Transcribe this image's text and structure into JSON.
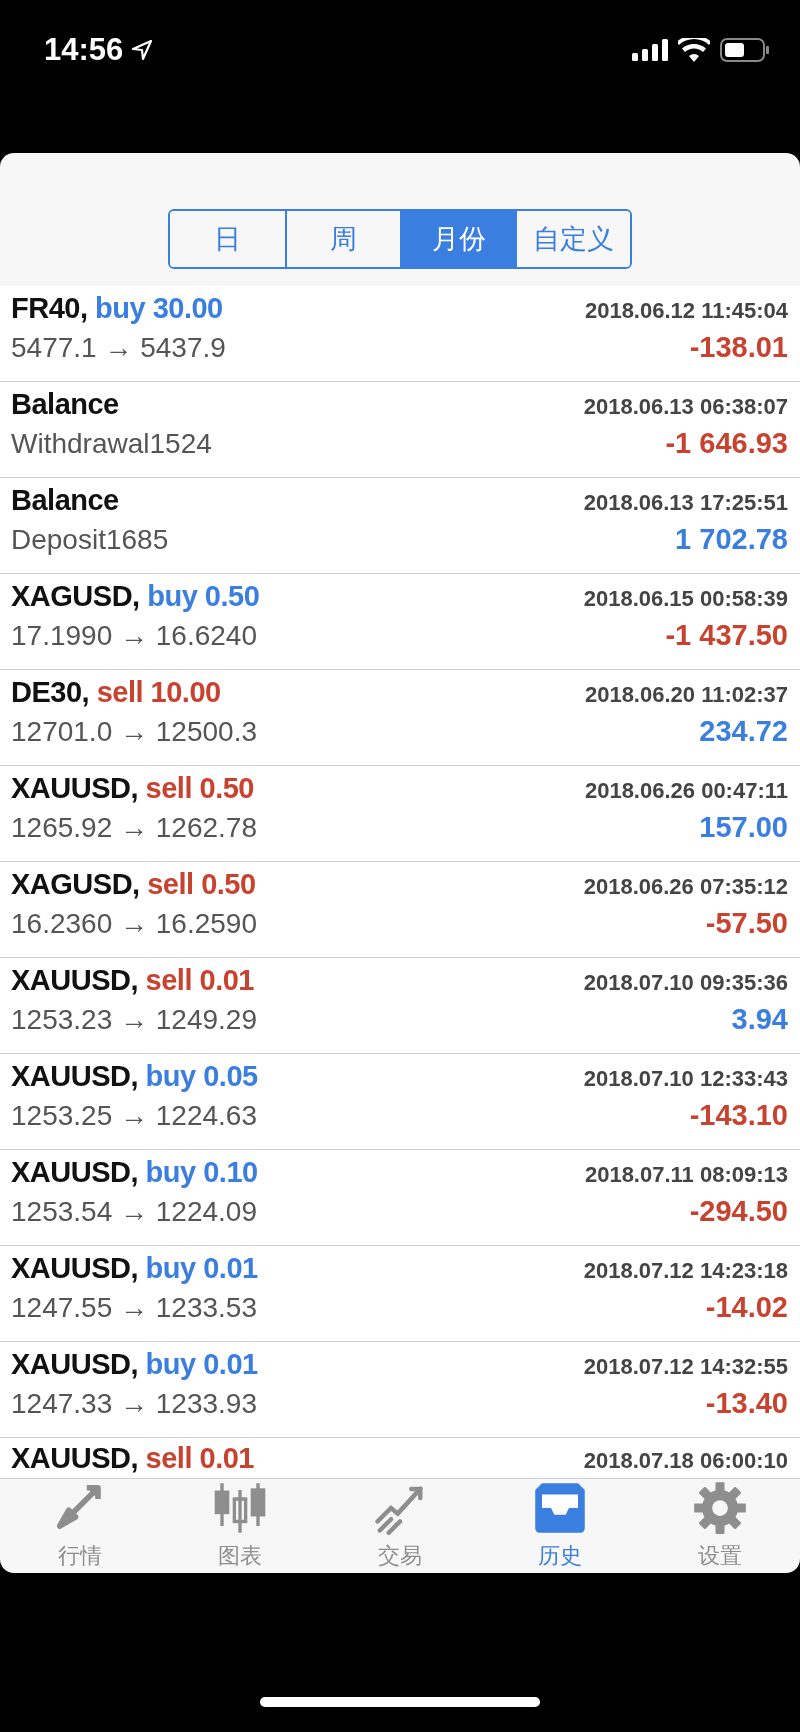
{
  "status_bar": {
    "time": "14:56"
  },
  "period_tabs": [
    {
      "label": "日",
      "selected": false
    },
    {
      "label": "周",
      "selected": false
    },
    {
      "label": "月份",
      "selected": true
    },
    {
      "label": "自定义",
      "selected": false
    }
  ],
  "history": [
    {
      "symbol": "FR40,",
      "action": {
        "text": "buy 30.00",
        "kind": "buy"
      },
      "time": "2018.06.12 11:45:04",
      "detail": "5477.1 → 5437.9",
      "profit": {
        "text": "-138.01",
        "kind": "loss"
      }
    },
    {
      "symbol": "Balance",
      "time": "2018.06.13 06:38:07",
      "detail": "Withdrawal1524",
      "profit": {
        "text": "-1 646.93",
        "kind": "loss"
      }
    },
    {
      "symbol": "Balance",
      "time": "2018.06.13 17:25:51",
      "detail": "Deposit1685",
      "profit": {
        "text": "1 702.78",
        "kind": "gain"
      }
    },
    {
      "symbol": "XAGUSD,",
      "action": {
        "text": "buy 0.50",
        "kind": "buy"
      },
      "time": "2018.06.15 00:58:39",
      "detail": "17.1990 → 16.6240",
      "profit": {
        "text": "-1 437.50",
        "kind": "loss"
      }
    },
    {
      "symbol": "DE30,",
      "action": {
        "text": "sell 10.00",
        "kind": "sell"
      },
      "time": "2018.06.20 11:02:37",
      "detail": "12701.0 → 12500.3",
      "profit": {
        "text": "234.72",
        "kind": "gain"
      }
    },
    {
      "symbol": "XAUUSD,",
      "action": {
        "text": "sell 0.50",
        "kind": "sell"
      },
      "time": "2018.06.26 00:47:11",
      "detail": "1265.92 → 1262.78",
      "profit": {
        "text": "157.00",
        "kind": "gain"
      }
    },
    {
      "symbol": "XAGUSD,",
      "action": {
        "text": "sell 0.50",
        "kind": "sell"
      },
      "time": "2018.06.26 07:35:12",
      "detail": "16.2360 → 16.2590",
      "profit": {
        "text": "-57.50",
        "kind": "loss"
      }
    },
    {
      "symbol": "XAUUSD,",
      "action": {
        "text": "sell 0.01",
        "kind": "sell"
      },
      "time": "2018.07.10 09:35:36",
      "detail": "1253.23 → 1249.29",
      "profit": {
        "text": "3.94",
        "kind": "gain"
      }
    },
    {
      "symbol": "XAUUSD,",
      "action": {
        "text": "buy 0.05",
        "kind": "buy"
      },
      "time": "2018.07.10 12:33:43",
      "detail": "1253.25 → 1224.63",
      "profit": {
        "text": "-143.10",
        "kind": "loss"
      }
    },
    {
      "symbol": "XAUUSD,",
      "action": {
        "text": "buy 0.10",
        "kind": "buy"
      },
      "time": "2018.07.11 08:09:13",
      "detail": "1253.54 → 1224.09",
      "profit": {
        "text": "-294.50",
        "kind": "loss"
      }
    },
    {
      "symbol": "XAUUSD,",
      "action": {
        "text": "buy 0.01",
        "kind": "buy"
      },
      "time": "2018.07.12 14:23:18",
      "detail": "1247.55 → 1233.53",
      "profit": {
        "text": "-14.02",
        "kind": "loss"
      }
    },
    {
      "symbol": "XAUUSD,",
      "action": {
        "text": "buy 0.01",
        "kind": "buy"
      },
      "time": "2018.07.12 14:32:55",
      "detail": "1247.33 → 1233.93",
      "profit": {
        "text": "-13.40",
        "kind": "loss"
      }
    },
    {
      "symbol": "XAUUSD,",
      "action": {
        "text": "sell 0.01",
        "kind": "sell"
      },
      "time": "2018.07.18 06:00:10"
    }
  ],
  "tab_bar": [
    {
      "label": "行情",
      "kind": "arrows",
      "selected": false
    },
    {
      "label": "图表",
      "kind": "candles",
      "selected": false
    },
    {
      "label": "交易",
      "kind": "trend",
      "selected": false
    },
    {
      "label": "历史",
      "kind": "tray",
      "selected": true
    },
    {
      "label": "设置",
      "kind": "gear",
      "selected": false
    }
  ]
}
